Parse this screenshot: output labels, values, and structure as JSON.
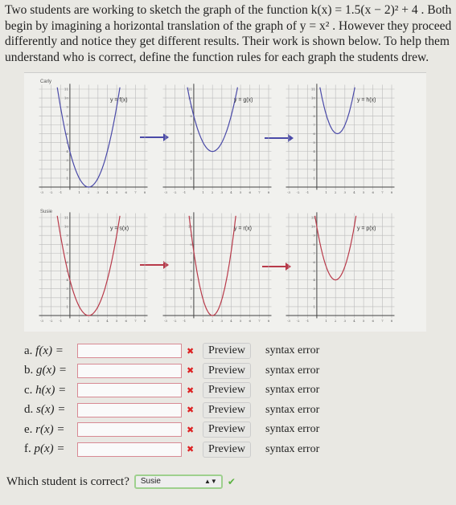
{
  "prompt": "Two students are working to sketch the graph of the function k(x) = 1.5(x − 2)² + 4 . Both begin by imagining a horizontal translation of the graph of y = x² . However they proceed differently and notice they get different results. Their work is shown below. To help them understand who is correct, define the function rules for each graph the students drew.",
  "students": [
    "Carly",
    "Susie"
  ],
  "graph_axes": {
    "x_range": [
      -3,
      8
    ],
    "y_range": [
      0,
      11
    ]
  },
  "graphs": [
    {
      "label": "y = f(x)",
      "a": 1,
      "h": 2,
      "k": 0,
      "color": "#4a4aa8"
    },
    {
      "label": "y = g(x)",
      "a": 1,
      "h": 2,
      "k": 4,
      "color": "#4a4aa8"
    },
    {
      "label": "y = h(x)",
      "a": 1.5,
      "h": 2.2,
      "k": 6,
      "color": "#4a4aa8"
    },
    {
      "label": "y = s(x)",
      "a": 1,
      "h": 2,
      "k": 0,
      "color": "#b83a4a"
    },
    {
      "label": "y = r(x)",
      "a": 1.8,
      "h": 2,
      "k": 0,
      "color": "#b83a4a"
    },
    {
      "label": "y = p(x)",
      "a": 1.5,
      "h": 2,
      "k": 4,
      "color": "#b83a4a"
    }
  ],
  "rows": [
    {
      "letter": "a.",
      "fn": "f(x) =",
      "value": "",
      "status": "syntax error"
    },
    {
      "letter": "b.",
      "fn": "g(x) =",
      "value": "",
      "status": "syntax error"
    },
    {
      "letter": "c.",
      "fn": "h(x) =",
      "value": "",
      "status": "syntax error"
    },
    {
      "letter": "d.",
      "fn": "s(x) =",
      "value": "",
      "status": "syntax error"
    },
    {
      "letter": "e.",
      "fn": "r(x) =",
      "value": "",
      "status": "syntax error"
    },
    {
      "letter": "f.",
      "fn": "p(x) =",
      "value": "",
      "status": "syntax error"
    }
  ],
  "preview_label": "Preview",
  "question": "Which student is correct?",
  "answer": "Susie"
}
